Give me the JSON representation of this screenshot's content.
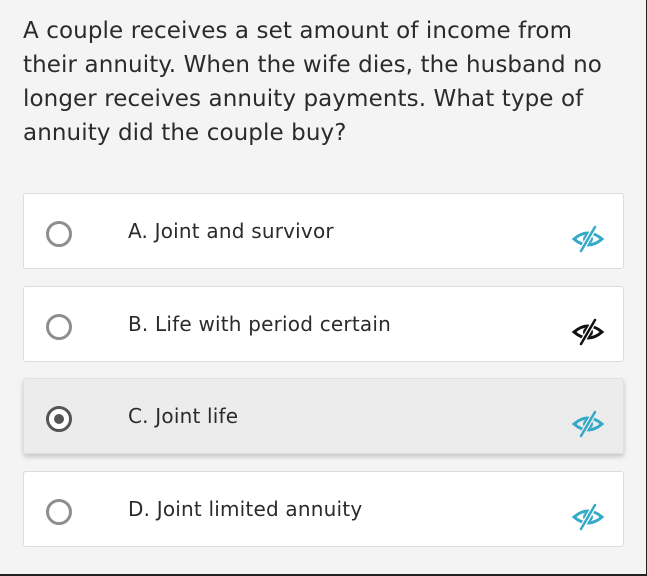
{
  "question": "A couple receives a set amount of income from their annuity. When the wife dies, the husband no longer receives annuity payments. What type of annuity did the couple buy?",
  "options": [
    {
      "label": "A. Joint and survivor",
      "selected": false,
      "hide_icon": "eye-slash-icon",
      "icon_color": "#33aac8"
    },
    {
      "label": "B. Life with period certain",
      "selected": false,
      "hide_icon": "eye-slash-icon",
      "icon_color": "#111111"
    },
    {
      "label": "C. Joint life",
      "selected": true,
      "hide_icon": "eye-slash-icon",
      "icon_color": "#33aac8"
    },
    {
      "label": "D. Joint limited annuity",
      "selected": false,
      "hide_icon": "eye-slash-icon",
      "icon_color": "#33aac8"
    }
  ],
  "colors": {
    "accent": "#33aac8",
    "selected_bg": "#ececec"
  }
}
